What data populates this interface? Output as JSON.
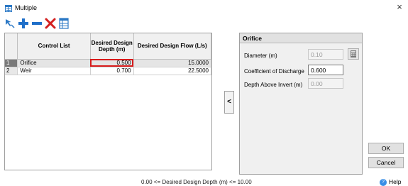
{
  "window": {
    "title": "Multiple",
    "close_glyph": "×"
  },
  "toolbar": {
    "icons": [
      "select-icon",
      "add-icon",
      "remove-icon",
      "delete-icon",
      "table-icon"
    ]
  },
  "grid": {
    "columns": {
      "control_list": "Control List",
      "depth": "Desired Design Depth (m)",
      "flow": "Desired Design Flow (L/s)"
    },
    "rows": [
      {
        "index": "1",
        "name": "Orifice",
        "depth": "0.500",
        "flow": "15.0000"
      },
      {
        "index": "2",
        "name": "Weir",
        "depth": "0.700",
        "flow": "22.5000"
      }
    ]
  },
  "collapse_button": "<",
  "panel": {
    "title": "Orifice",
    "diameter_label": "Diameter (m)",
    "diameter_value": "0.10",
    "coefficient_label": "Coefficient of Discharge",
    "coefficient_value": "0.600",
    "depth_invert_label": "Depth Above Invert (m)",
    "depth_invert_value": "0.00"
  },
  "buttons": {
    "ok": "OK",
    "cancel": "Cancel",
    "help": "Help"
  },
  "status": "0.00 <= Desired Design Depth (m) <= 10.00",
  "colors": {
    "accent": "#2b78c5",
    "focus_border": "#d81b1b",
    "add_icon": "#1f6fc9",
    "delete_icon": "#d32020"
  }
}
